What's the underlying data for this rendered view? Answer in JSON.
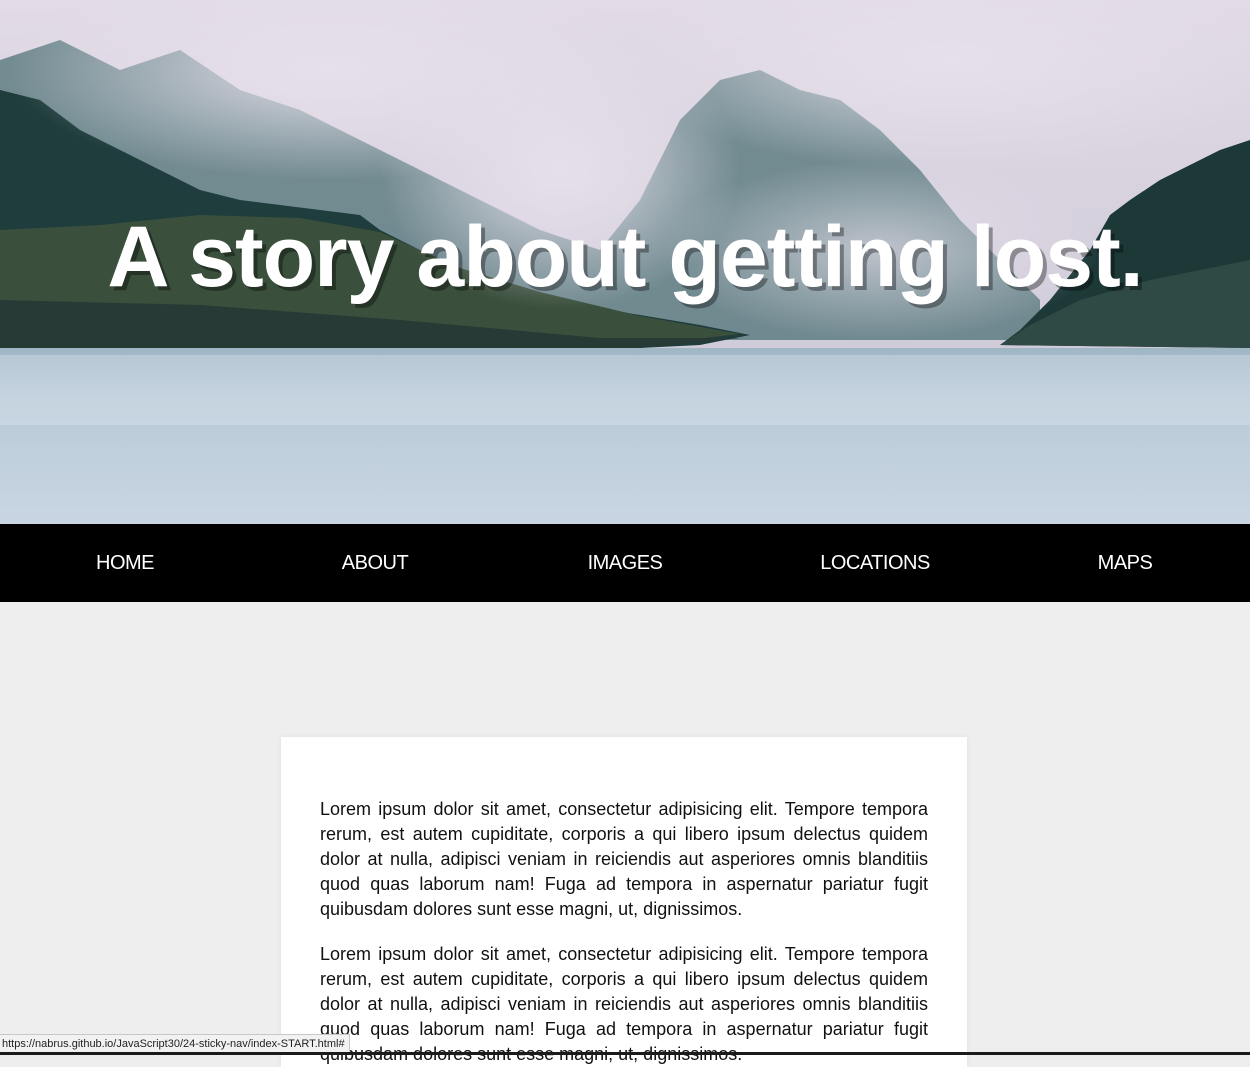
{
  "hero": {
    "title": "A story about getting lost."
  },
  "nav": {
    "items": [
      {
        "label": "HOME"
      },
      {
        "label": "ABOUT"
      },
      {
        "label": "IMAGES"
      },
      {
        "label": "LOCATIONS"
      },
      {
        "label": "MAPS"
      }
    ]
  },
  "content": {
    "paragraphs": [
      "Lorem ipsum dolor sit amet, consectetur adipisicing elit. Tempore tempora rerum, est autem cupiditate, corporis a qui libero ipsum delectus quidem dolor at nulla, adipisci veniam in reiciendis aut asperiores omnis blanditiis quod quas laborum nam! Fuga ad tempora in aspernatur pariatur fugit quibusdam dolores sunt esse magni, ut, dignissimos.",
      "Lorem ipsum dolor sit amet, consectetur adipisicing elit. Tempore tempora rerum, est autem cupiditate, corporis a qui libero ipsum delectus quidem dolor at nulla, adipisci veniam in reiciendis aut asperiores omnis blanditiis quod quas laborum nam! Fuga ad tempora in aspernatur pariatur fugit quibusdam dolores sunt esse magni, ut, dignissimos."
    ]
  },
  "status_bar": {
    "url": "https://nabrus.github.io/JavaScript30/24-sticky-nav/index-START.html#"
  },
  "colors": {
    "nav_background": "#000000",
    "page_background": "#eeeeee",
    "content_background": "#ffffff"
  }
}
